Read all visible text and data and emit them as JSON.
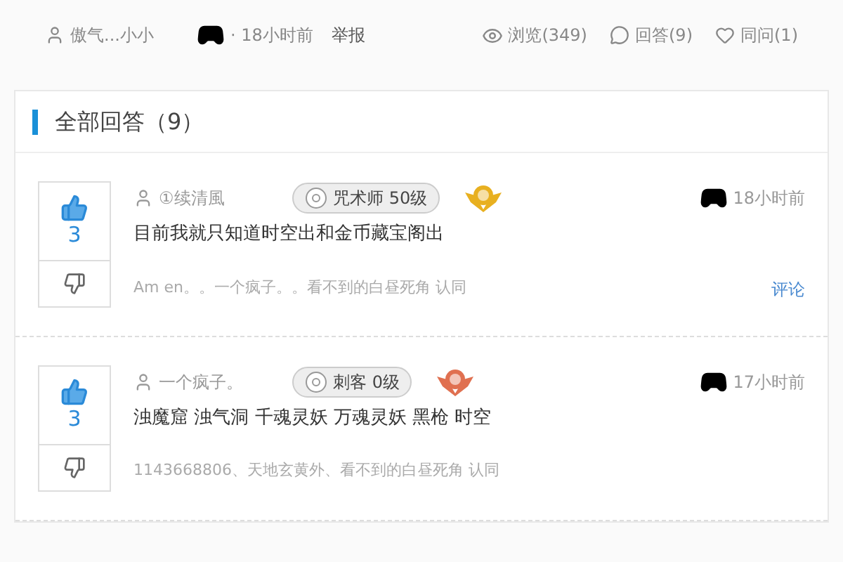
{
  "question_meta": {
    "author": "傲气...小小",
    "time": "· 18小时前",
    "report": "举报",
    "views": "浏览(349)",
    "answers": "回答(9)",
    "follows": "同问(1)"
  },
  "answers_header": "全部回答（9）",
  "answers": [
    {
      "votes": "3",
      "user": "①续清風",
      "rank": "咒术师 50级",
      "color": "#e8b020",
      "time": "18小时前",
      "content": "目前我就只知道时空出和金币藏宝阁出",
      "agree": "Am en。。一个疯子。。看不到的白昼死角 认同",
      "comment": "评论"
    },
    {
      "votes": "3",
      "user": "一个疯子。",
      "rank": "刺客 0级",
      "color": "#e07050",
      "time": "17小时前",
      "content": "浊魔窟 浊气洞 千魂灵妖 万魂灵妖 黑枪 时空",
      "agree": "1143668806、天地玄黄外、看不到的白昼死角 认同"
    }
  ]
}
